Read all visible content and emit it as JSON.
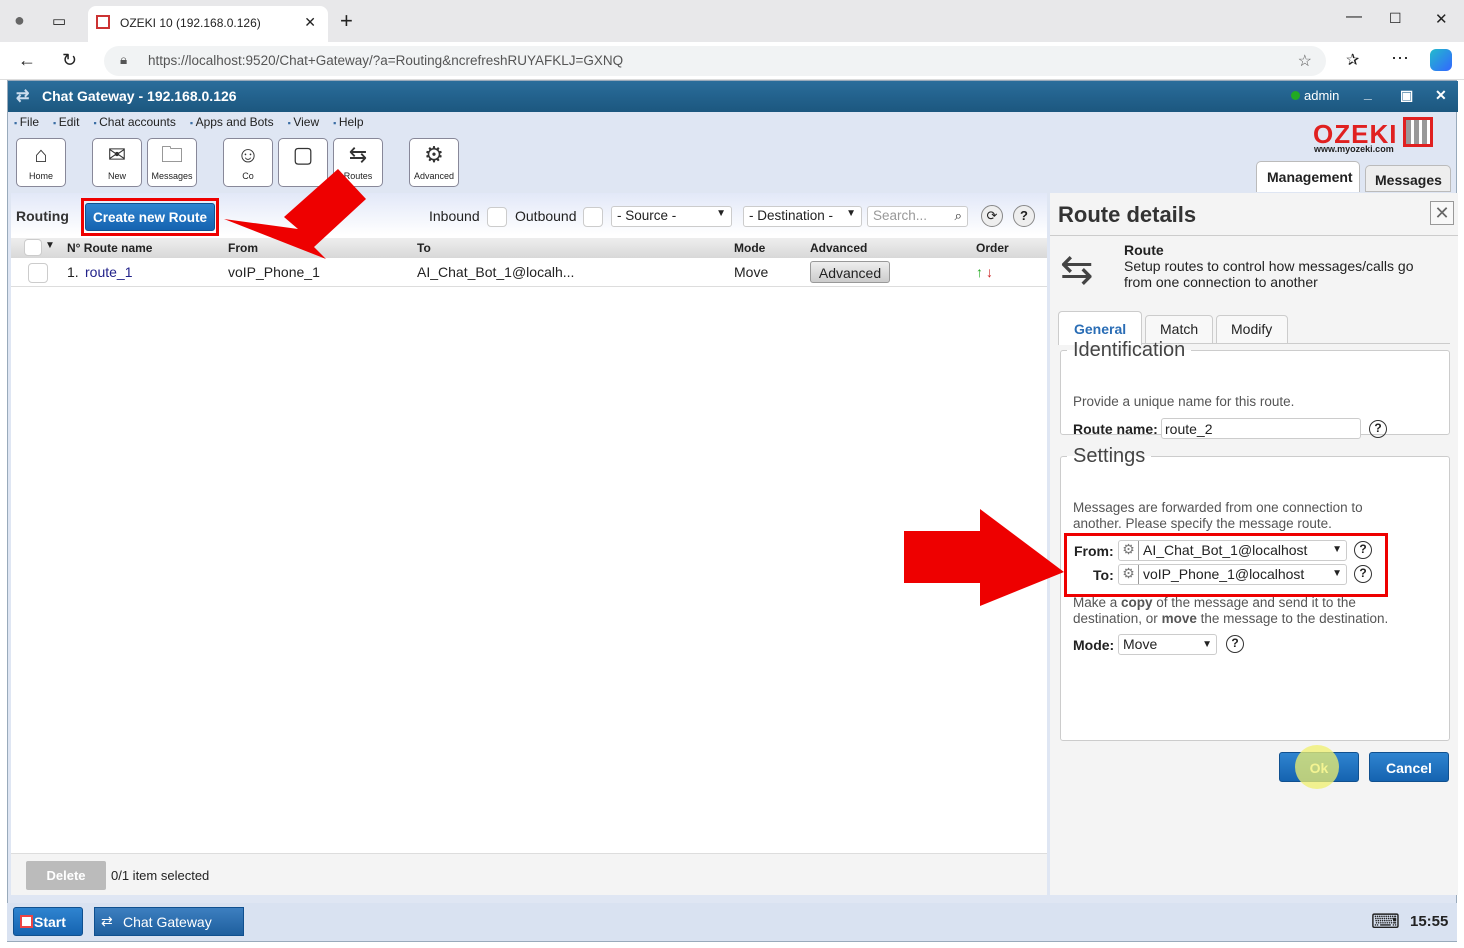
{
  "browser": {
    "tab_title": "OZEKI 10 (192.168.0.126)",
    "url": "https://localhost:9520/Chat+Gateway/?a=Routing&ncrefreshRUYAFKLJ=GXNQ"
  },
  "app": {
    "title": "Chat Gateway - 192.168.0.126",
    "user": "admin",
    "status_color": "#22aa22"
  },
  "menu": [
    "File",
    "Edit",
    "Chat accounts",
    "Apps and Bots",
    "View",
    "Help"
  ],
  "toolbar": [
    {
      "label": "Home",
      "icon": "home-icon"
    },
    {
      "label": "New",
      "icon": "new-message-icon"
    },
    {
      "label": "Messages",
      "icon": "folder-icon"
    },
    {
      "label": "Co",
      "icon": "contacts-icon"
    },
    {
      "label": "",
      "icon": "chat-icon"
    },
    {
      "label": "Routes",
      "icon": "routes-icon"
    },
    {
      "label": "Advanced",
      "icon": "gear-icon"
    }
  ],
  "logo": {
    "text": "OZEKI",
    "url": "www.myozeki.com"
  },
  "top_tabs": [
    "Management",
    "Messages"
  ],
  "routing": {
    "title": "Routing",
    "create_button": "Create new Route",
    "inbound": "Inbound",
    "outbound": "Outbound",
    "source": "- Source -",
    "destination": "- Destination -",
    "search_placeholder": "Search..."
  },
  "table": {
    "headers": [
      "N° Route name",
      "From",
      "To",
      "Mode",
      "Advanced",
      "Order"
    ],
    "rows": [
      {
        "num": "1.",
        "name": "route_1",
        "from": "voIP_Phone_1",
        "to": "AI_Chat_Bot_1@localh...",
        "mode": "Move",
        "advanced": "Advanced"
      }
    ]
  },
  "footer": {
    "delete": "Delete",
    "selected": "0/1 item selected"
  },
  "details": {
    "title": "Route details",
    "heading": "Route",
    "desc": "Setup routes to control how messages/calls go from one connection to another",
    "tabs": [
      "General",
      "Match",
      "Modify"
    ],
    "identification": {
      "legend": "Identification",
      "text": "Provide a unique name for this route.",
      "name_label": "Route name:",
      "name_value": "route_2"
    },
    "settings": {
      "legend": "Settings",
      "text": "Messages are forwarded from one connection to another. Please specify the message route.",
      "from_label": "From:",
      "from_value": "AI_Chat_Bot_1@localhost",
      "to_label": "To:",
      "to_value": "voIP_Phone_1@localhost",
      "mode_text_1": "Make a ",
      "copy": "copy",
      "mode_text_2": " of the message and send it to the destination, or ",
      "move": "move",
      "mode_text_3": " the message to the destination.",
      "mode_label": "Mode:",
      "mode_value": "Move"
    },
    "ok": "Ok",
    "cancel": "Cancel"
  },
  "taskbar": {
    "start": "Start",
    "app": "Chat Gateway",
    "time": "15:55"
  },
  "colors": {
    "accent": "#1a66b3",
    "annotation": "#ee0000"
  }
}
